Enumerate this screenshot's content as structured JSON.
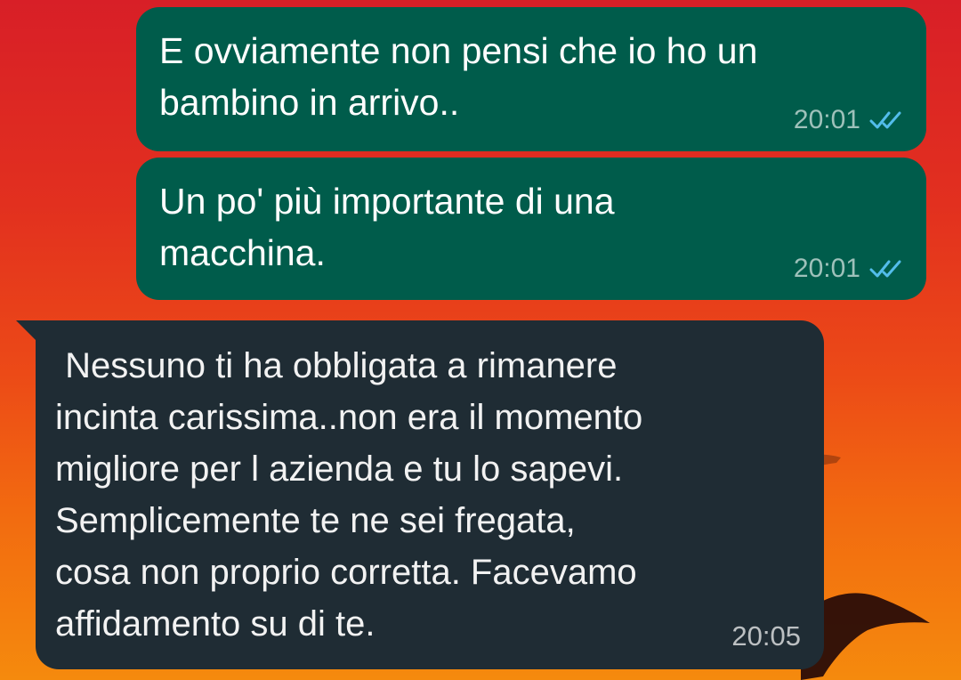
{
  "colors": {
    "outgoing_bubble": "#005c4b",
    "incoming_bubble": "#1f2c34",
    "read_receipt": "#53bdeb",
    "background_top": "#d81f27",
    "background_bottom": "#f58a0d"
  },
  "messages": [
    {
      "direction": "outgoing",
      "text": "E ovviamente non pensi che io ho un\nbambino in arrivo..",
      "time": "20:01",
      "status_icon": "double-check-read-icon"
    },
    {
      "direction": "outgoing",
      "text": "Un po' più importante di una\nmacchina.",
      "time": "20:01",
      "status_icon": "double-check-read-icon"
    },
    {
      "direction": "incoming",
      "text": " Nessuno ti ha obbligata a rimanere\nincinta carissima..non era il momento\nmigliore per l azienda e tu lo sapevi.\nSemplicemente te ne sei fregata,\ncosa non proprio corretta. Facevamo\naffidamento su di te.",
      "time": "20:05"
    }
  ]
}
